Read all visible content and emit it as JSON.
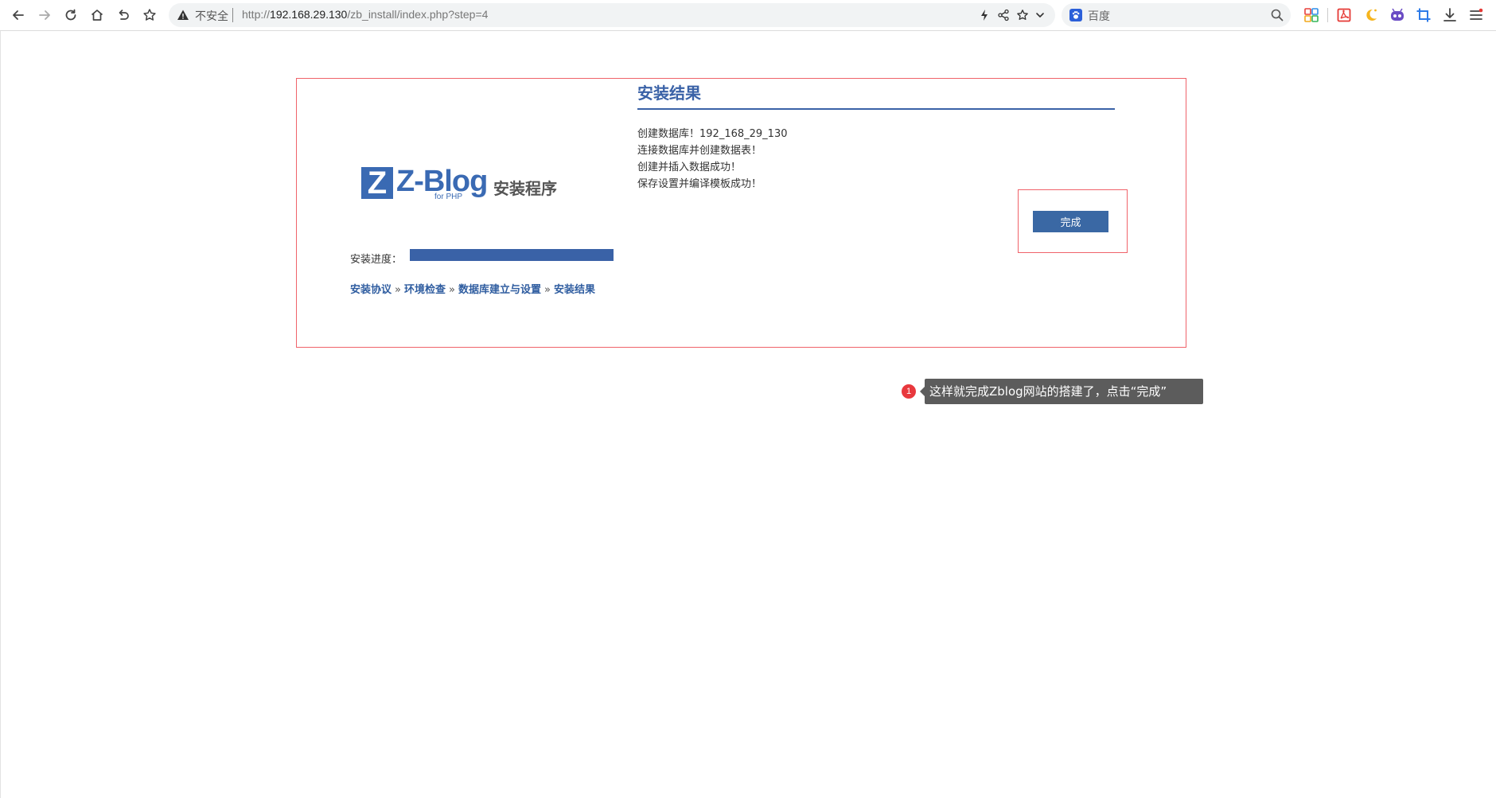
{
  "browser": {
    "security_label": "不安全",
    "url_prefix": "http://",
    "url_host": "192.168.29.130",
    "url_path": "/zb_install/index.php?step=4",
    "search_placeholder": "百度"
  },
  "icons": {
    "back": "arrow-left-icon",
    "forward": "arrow-right-icon",
    "reload": "reload-icon",
    "home": "home-icon",
    "undo": "undo-icon",
    "favorite": "star-icon",
    "warning": "warning-triangle-icon",
    "lightning": "lightning-icon",
    "share": "share-icon",
    "bookmark": "star-icon",
    "dropdown": "chevron-down-icon",
    "search": "search-icon",
    "apps": "apps-grid-icon",
    "pdf": "pdf-icon",
    "night": "moon-icon",
    "robot": "robot-icon",
    "crop": "crop-icon",
    "download": "download-icon",
    "menu": "menu-icon"
  },
  "installer": {
    "logo_letter": "Z",
    "logo_name": "Z-Blog",
    "logo_for": "for PHP",
    "logo_subtitle": "安装程序",
    "progress_label": "安装进度：",
    "progress": 1.0,
    "steps": [
      "安装协议",
      "环境检查",
      "数据库建立与设置",
      "安装结果"
    ],
    "step_separator": "»",
    "result_title": "安装结果",
    "messages": [
      "创建数据库！192_168_29_130",
      "连接数据库并创建数据表！",
      "创建并插入数据成功！",
      "保存设置并编译模板成功！"
    ],
    "finish_button": "完成"
  },
  "annotation": {
    "badge": "1",
    "text": "这样就完成Zblog网站的搭建了，点击“完成”"
  },
  "colors": {
    "brand_blue": "#3a62a7",
    "highlight_red": "#f0636a",
    "tooltip_bg": "#5c5c5c",
    "badge_red": "#e8383d"
  }
}
